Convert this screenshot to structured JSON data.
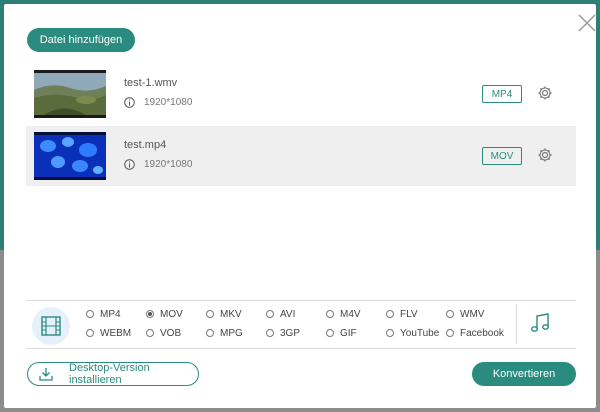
{
  "toolbar": {
    "add_file_label": "Datei hinzufügen"
  },
  "files": [
    {
      "name": "test-1.wmv",
      "resolution": "1920*1080",
      "target_format": "MP4",
      "thumbnail": "landscape-thumbnail"
    },
    {
      "name": "test.mp4",
      "resolution": "1920*1080",
      "target_format": "MOV",
      "thumbnail": "jellyfish-thumbnail"
    }
  ],
  "formats": {
    "selected": "MOV",
    "options": [
      "MP4",
      "MOV",
      "MKV",
      "AVI",
      "M4V",
      "FLV",
      "WMV",
      "WEBM",
      "VOB",
      "MPG",
      "3GP",
      "GIF",
      "YouTube",
      "Facebook"
    ]
  },
  "footer": {
    "desktop_label": "Desktop-Version installieren",
    "convert_label": "Konvertieren"
  },
  "colors": {
    "accent": "#2a8c7e",
    "row_alt": "#efefef",
    "video_tab_bg": "#e6f0fb"
  },
  "icons": {
    "close": "close-icon",
    "info": "info-icon",
    "settings": "gear-icon",
    "video": "film-icon",
    "audio": "music-note-icon",
    "download": "download-icon"
  }
}
